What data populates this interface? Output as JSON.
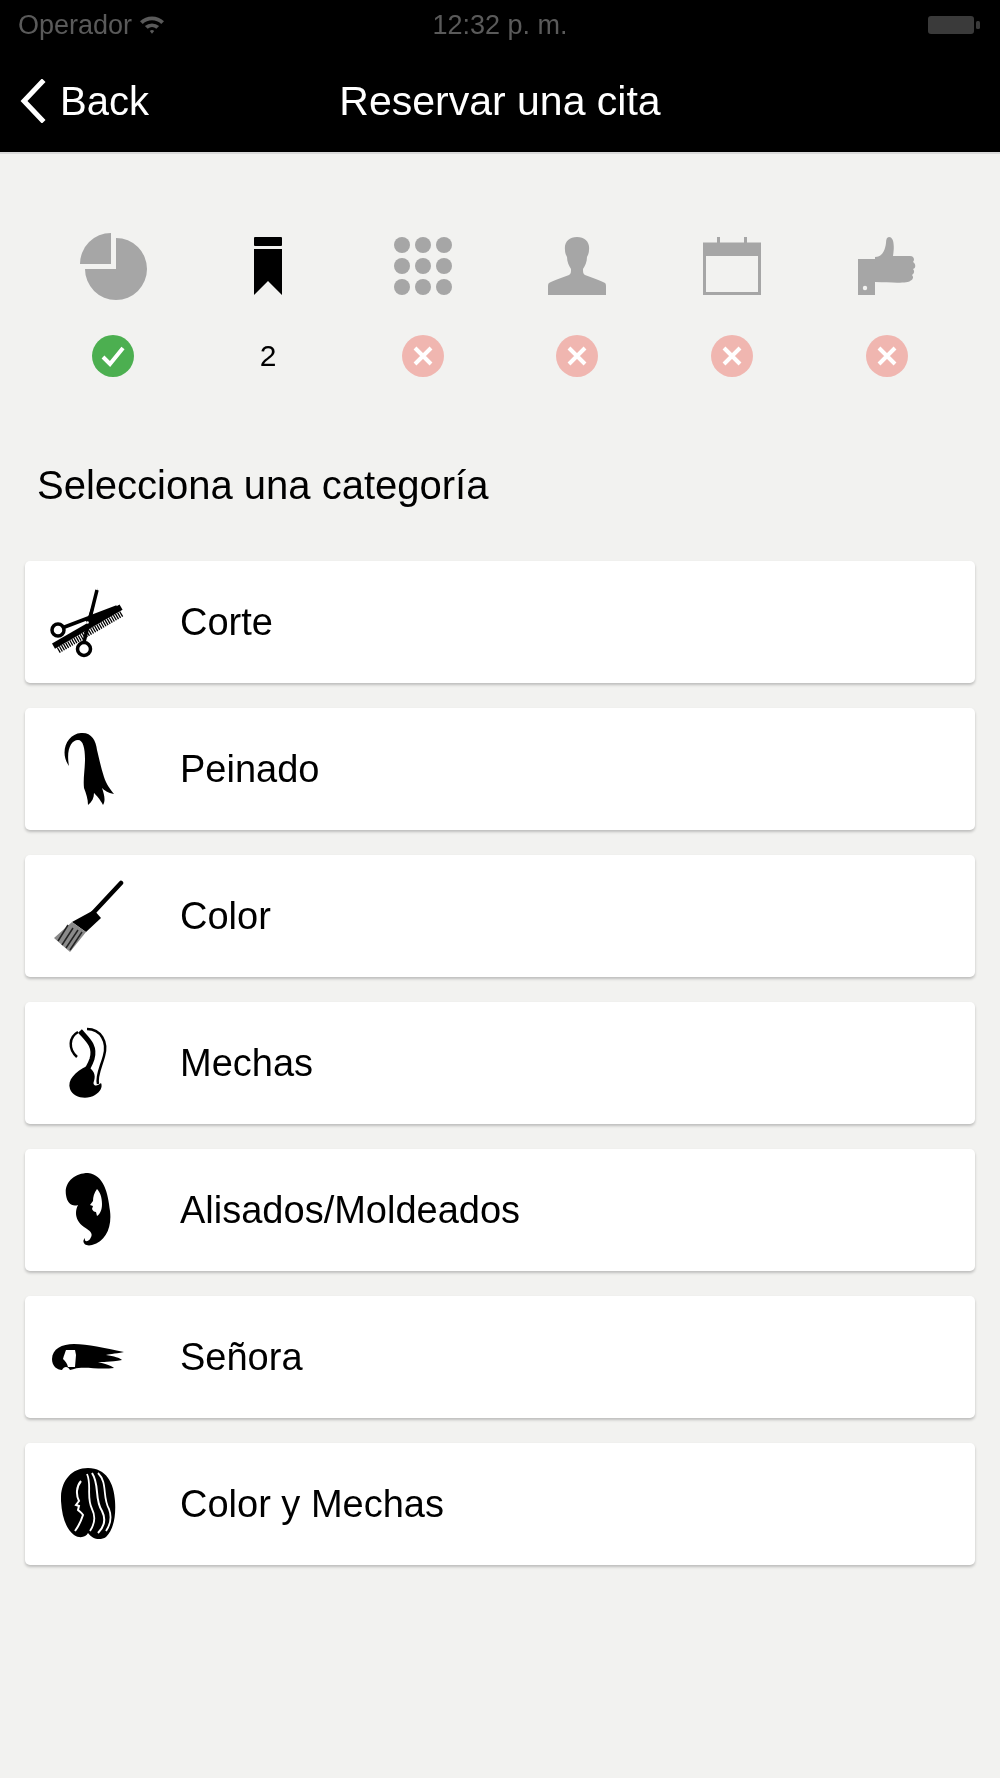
{
  "status_bar": {
    "carrier": "Operador",
    "time": "12:32 p. m."
  },
  "nav": {
    "back_label": "Back",
    "title": "Reservar una cita"
  },
  "steps": [
    {
      "selected": false,
      "kind": "done"
    },
    {
      "selected": true,
      "kind": "current",
      "label": "2"
    },
    {
      "selected": false,
      "kind": "pending"
    },
    {
      "selected": false,
      "kind": "pending"
    },
    {
      "selected": false,
      "kind": "pending"
    },
    {
      "selected": false,
      "kind": "pending"
    }
  ],
  "heading": "Selecciona una categoría",
  "categories": [
    {
      "label": "Corte"
    },
    {
      "label": "Peinado"
    },
    {
      "label": "Color"
    },
    {
      "label": "Mechas"
    },
    {
      "label": "Alisados/Moldeados"
    },
    {
      "label": "Señora"
    },
    {
      "label": "Color y Mechas"
    }
  ]
}
